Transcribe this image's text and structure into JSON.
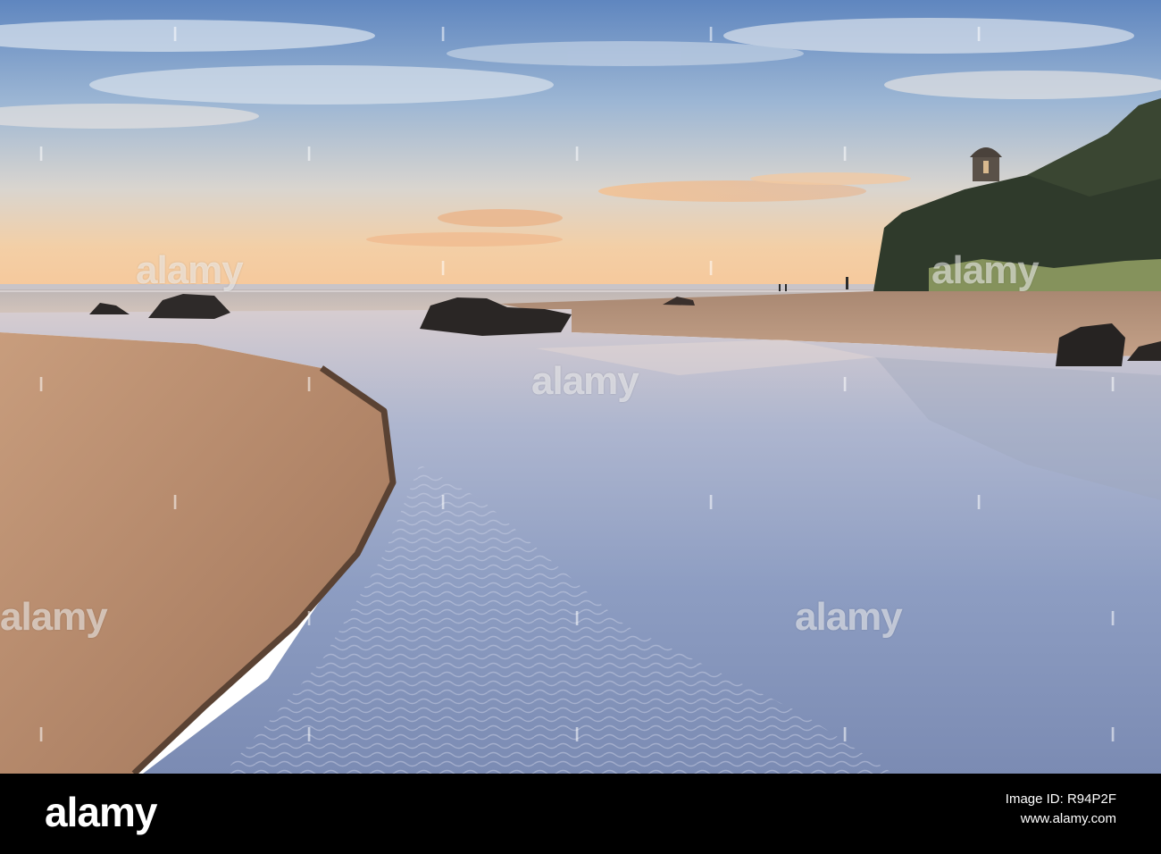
{
  "photo": {
    "watermark_text": "alamy",
    "scene_elements": [
      "sky-with-clouds",
      "sunset-horizon",
      "sea",
      "rocks",
      "cliff",
      "temple-on-cliff",
      "beach-sand",
      "tidal-stream"
    ]
  },
  "footer": {
    "logo": "alamy",
    "image_id_label": "Image ID: R94P2F",
    "site": "www.alamy.com"
  },
  "colors": {
    "sky_top": "#6f93c4",
    "sky_mid": "#b7c9dc",
    "horizon": "#f2c89a",
    "sand": "#b88c6e",
    "water": "#8c9cc0",
    "cliff": "#2f3b2c",
    "footer_bg": "#000000"
  }
}
